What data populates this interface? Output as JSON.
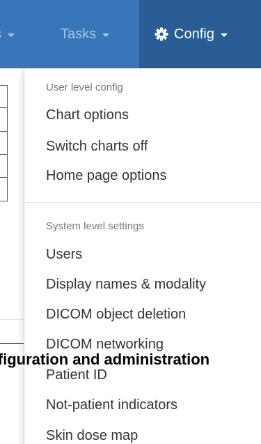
{
  "navbar": {
    "partial_item_label": "s",
    "tasks_label": "Tasks",
    "config_label": "Config"
  },
  "background": {
    "heading": "Configuration and administration"
  },
  "dropdown": {
    "user_header": "User level config",
    "user_items": [
      {
        "label": "Chart options"
      },
      {
        "label": "Switch charts off"
      },
      {
        "label": "Home page options"
      }
    ],
    "system_header": "System level settings",
    "system_items": [
      {
        "label": "Users"
      },
      {
        "label": "Display names & modality"
      },
      {
        "label": "DICOM object deletion"
      },
      {
        "label": "DICOM networking"
      },
      {
        "label": "Patient ID"
      },
      {
        "label": "Not-patient indicators"
      },
      {
        "label": "Skin dose map"
      }
    ]
  },
  "colors": {
    "navbar": "#3876b9",
    "navbar_active": "#2a5d96",
    "nav_text": "#a8c6e6",
    "menu_text": "#333333",
    "menu_header": "#777777"
  }
}
